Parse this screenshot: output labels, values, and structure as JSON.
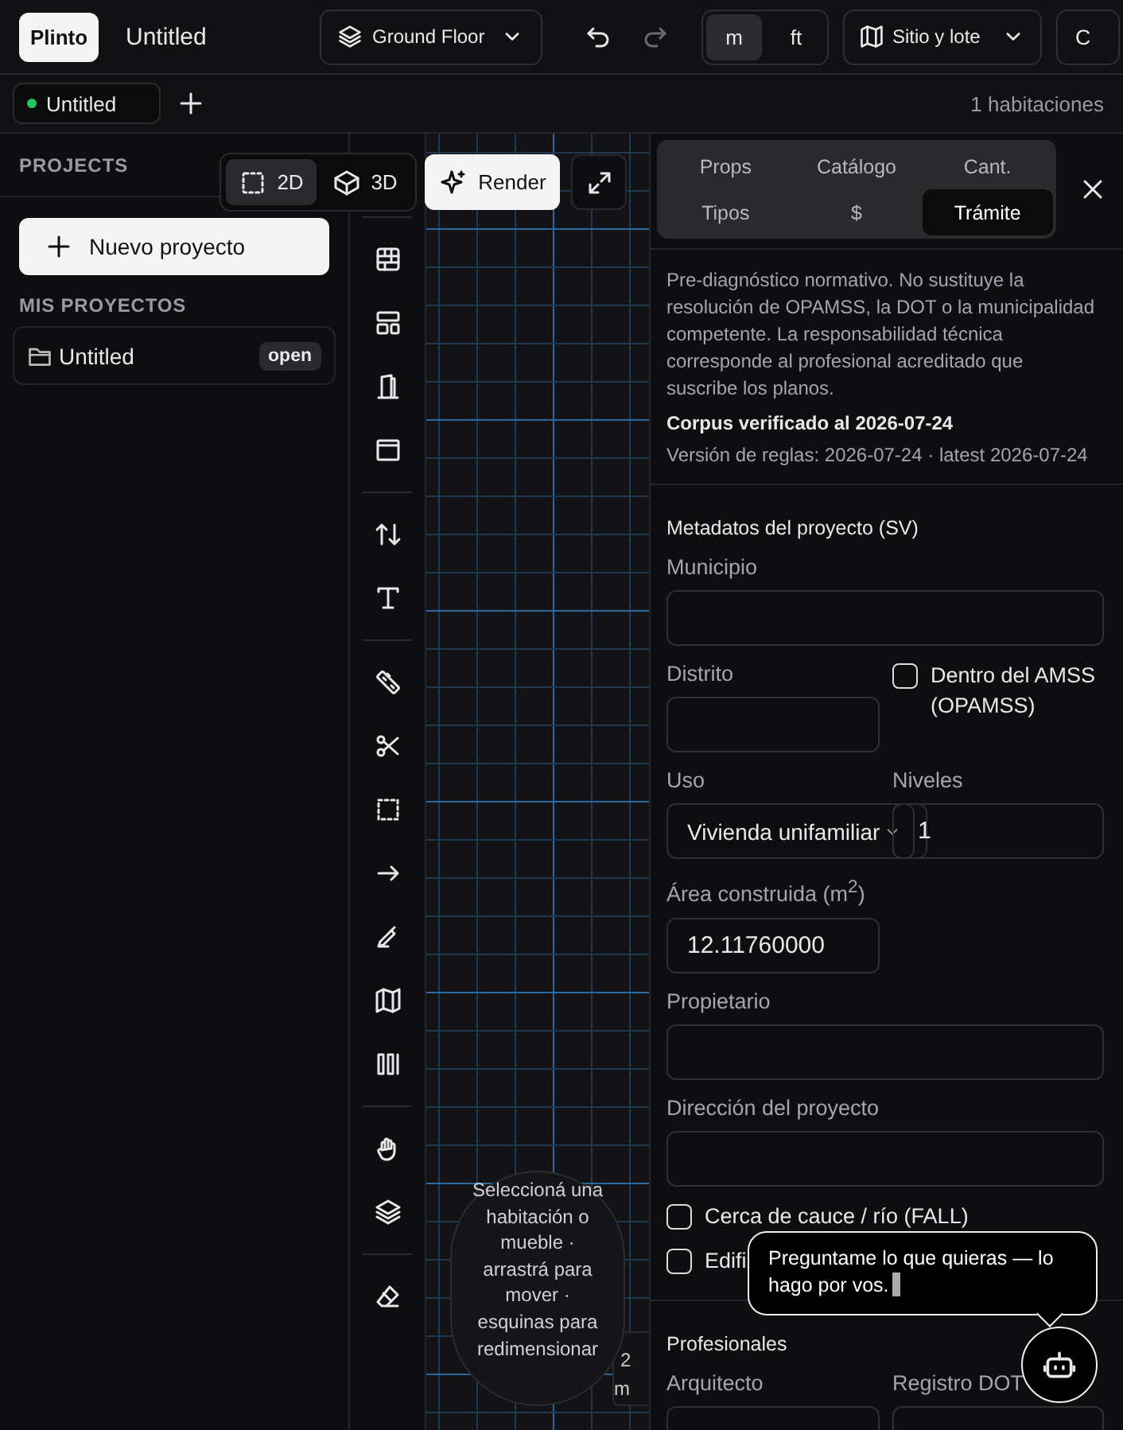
{
  "app": {
    "logo": "Plinto",
    "title": "Untitled"
  },
  "floor_selector": {
    "label": "Ground Floor"
  },
  "history": [
    {
      "kind": "undo",
      "disabled": false
    },
    {
      "kind": "redo",
      "disabled": true
    }
  ],
  "units": [
    {
      "label": "m",
      "selected": true
    },
    {
      "label": "ft",
      "selected": false
    }
  ],
  "site_button": {
    "label": "Sitio y lote"
  },
  "cut_button": {
    "label": "C"
  },
  "doc_tabs": [
    {
      "label": "Untitled",
      "selected": true
    }
  ],
  "room_count": "1 habitaciones",
  "sidebar": {
    "heading": "PROJECTS",
    "new_button": "Nuevo proyecto",
    "section": "MIS PROYECTOS",
    "projects": [
      {
        "name": "Untitled",
        "badge": "open"
      }
    ]
  },
  "view_modes": [
    {
      "label": "2D",
      "kind": "plane",
      "selected": true
    },
    {
      "label": "3D",
      "kind": "cube",
      "selected": false
    }
  ],
  "render_button": "Render",
  "tool_groups": [
    {
      "tools": [
        {
          "kind": "grid",
          "selected": false
        },
        {
          "kind": "layout",
          "selected": false
        },
        {
          "kind": "door",
          "selected": false
        },
        {
          "kind": "window",
          "selected": false
        }
      ]
    },
    {
      "tools": [
        {
          "kind": "stairs",
          "selected": false
        },
        {
          "kind": "text",
          "selected": false
        }
      ]
    },
    {
      "tools": [
        {
          "kind": "ruler",
          "selected": false
        },
        {
          "kind": "scissors",
          "selected": false
        },
        {
          "kind": "marquee",
          "selected": false
        },
        {
          "kind": "arrow",
          "selected": false
        },
        {
          "kind": "pen",
          "selected": false
        },
        {
          "kind": "map",
          "selected": false
        },
        {
          "kind": "columns",
          "selected": false
        }
      ]
    },
    {
      "tools": [
        {
          "kind": "hand",
          "selected": false
        },
        {
          "kind": "layers",
          "selected": false
        }
      ]
    },
    {
      "tools": [
        {
          "kind": "eraser",
          "selected": false
        }
      ]
    }
  ],
  "canvas": {
    "hint": "Seleccioná una habitación o mueble · arrastrá para mover · esquinas para redimensionar",
    "scale": "2 m"
  },
  "panel": {
    "tabs": [
      {
        "label": "Props",
        "selected": false
      },
      {
        "label": "Catálogo",
        "selected": false
      },
      {
        "label": "Cant.",
        "selected": false
      },
      {
        "label": "Tipos",
        "selected": false
      },
      {
        "label": "$",
        "selected": false
      },
      {
        "label": "Trámite",
        "selected": true
      }
    ],
    "notice": "Pre-diagnóstico normativo. No sustituye la resolución de OPAMSS, la DOT o la municipalidad competente. La responsabilidad técnica corresponde al profesional acreditado que suscribe los planos.",
    "corpus": "Corpus verificado al 2026-07-24",
    "rules_version": "Versión de reglas: 2026-07-24 · latest 2026-07-24",
    "sections": [
      {
        "title": "Metadatos del proyecto (SV)",
        "rows": [
          [
            {
              "kind": "input",
              "label": "Municipio",
              "wide": true
            }
          ],
          [
            {
              "kind": "input",
              "label": "Distrito",
              "wide": false
            },
            {
              "kind": "checkbox",
              "label": "Dentro del AMSS (OPAMSS)",
              "checked": false
            }
          ],
          [
            {
              "kind": "select",
              "label": "Uso",
              "value": "Vivienda unifamiliar"
            },
            {
              "kind": "number",
              "label": "Niveles",
              "value": "1"
            }
          ],
          [
            {
              "kind": "input",
              "label": "Área construida (m$^{2}$)",
              "value": "12.11760000",
              "wide": false
            }
          ],
          [
            {
              "kind": "input",
              "label": "Propietario",
              "wide": true
            }
          ],
          [
            {
              "kind": "input",
              "label": "Dirección del proyecto",
              "wide": true
            }
          ],
          [
            {
              "kind": "checkbox",
              "label": "Cerca de cauce / río (FALL)",
              "checked": false
            }
          ],
          [
            {
              "kind": "checkbox",
              "label": "Edifi",
              "checked": false
            }
          ]
        ]
      },
      {
        "title": "Profesionales",
        "rows": [
          [
            {
              "kind": "input",
              "label": "Arquitecto",
              "wide": false
            },
            {
              "kind": "input",
              "label": "Registro DOT",
              "wide": false
            }
          ]
        ]
      }
    ]
  },
  "assistant": {
    "message": "Preguntame lo que quieras — lo hago por vos."
  }
}
